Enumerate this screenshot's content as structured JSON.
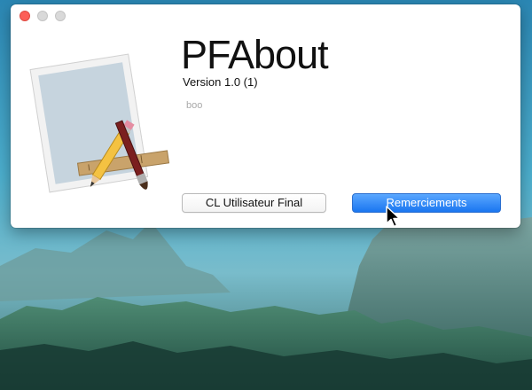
{
  "window": {
    "app_name": "PFAbout",
    "version": "Version 1.0 (1)",
    "copyright": "boo"
  },
  "buttons": {
    "eula_label": "CL Utilisateur Final",
    "acknowledgements_label": "Remerciements"
  },
  "icons": {
    "app_icon": "pfabout-app-icon",
    "cursor": "arrow-cursor-icon"
  },
  "colors": {
    "primary_button": "#1a76f0",
    "close_light": "#fc5f57"
  }
}
